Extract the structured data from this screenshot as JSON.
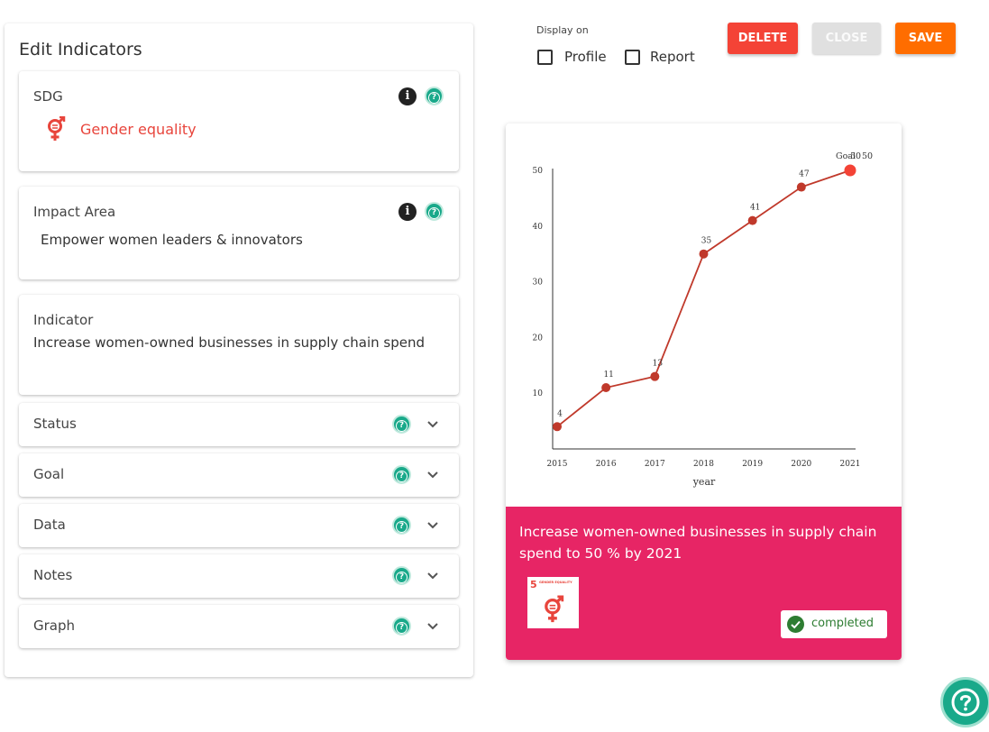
{
  "panel": {
    "title": "Edit Indicators",
    "sdg": {
      "label": "SDG",
      "value": "Gender equality",
      "color": "#e8453c"
    },
    "impact": {
      "label": "Impact Area",
      "value": "Empower women leaders & innovators"
    },
    "indicator": {
      "label": "Indicator",
      "value": "Increase women-owned businesses in supply chain spend"
    },
    "sections": [
      "Status",
      "Goal",
      "Data",
      "Notes",
      "Graph"
    ]
  },
  "controls": {
    "display_on": "Display on",
    "profile": "Profile",
    "report": "Report",
    "delete": "DELETE",
    "close": "CLOSE",
    "save": "SAVE"
  },
  "colors": {
    "delete": "#f44336",
    "close": "#e0e0e0",
    "save": "#ff6d00",
    "accent": "#19a98a",
    "card_bottom": "#e72565"
  },
  "chart_data": {
    "type": "line",
    "x": [
      "2015",
      "2016",
      "2017",
      "2018",
      "2019",
      "2020",
      "2021"
    ],
    "values": [
      4,
      11,
      13,
      35,
      41,
      47,
      50
    ],
    "data_labels": [
      "4",
      "11",
      "13",
      "35",
      "41",
      "47",
      "50"
    ],
    "goal_label": "Goal",
    "goal_value": 50,
    "xlabel": "year",
    "ylabel": "",
    "yticks": [
      10,
      20,
      30,
      40,
      50
    ],
    "ylim": [
      0,
      50
    ],
    "line_color": "#c0392b",
    "goal_color": "#f44336"
  },
  "card": {
    "description": "Increase women-owned businesses in supply chain spend to 50 % by 2021",
    "sdg_number": "5",
    "sdg_text": "GENDER EQUALITY",
    "status": "completed"
  }
}
